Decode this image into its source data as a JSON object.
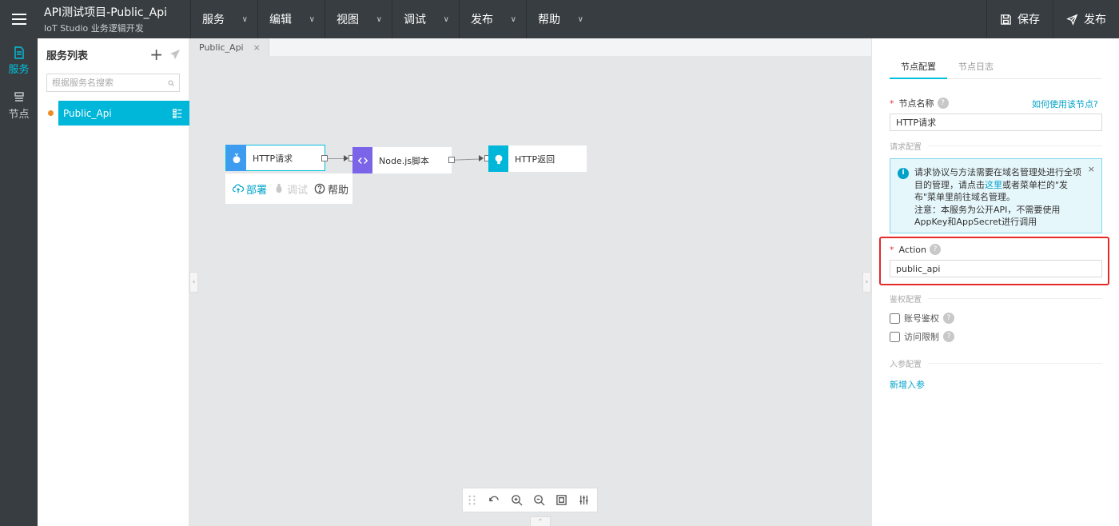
{
  "header": {
    "project_title": "API测试项目-Public_Api",
    "subtitle": "IoT Studio 业务逻辑开发",
    "menus": [
      {
        "label": "服务"
      },
      {
        "label": "编辑"
      },
      {
        "label": "视图"
      },
      {
        "label": "调试"
      },
      {
        "label": "发布"
      },
      {
        "label": "帮助"
      }
    ],
    "save_label": "保存",
    "publish_label": "发布"
  },
  "rail": {
    "items": [
      {
        "label": "服务",
        "icon": "document-icon",
        "active": true
      },
      {
        "label": "节点",
        "icon": "node-list-icon",
        "active": false
      }
    ]
  },
  "service_list": {
    "title": "服务列表",
    "search_placeholder": "根据服务名搜索",
    "items": [
      {
        "name": "Public_Api",
        "selected": true,
        "status_color": "#f08a24"
      }
    ]
  },
  "canvas": {
    "tab": {
      "label": "Public_Api",
      "close": "×"
    },
    "nodes": [
      {
        "label": "HTTP请求",
        "icon": "http-request-icon",
        "color": "#3d9cf0"
      },
      {
        "label": "Node.js脚本",
        "icon": "code-icon",
        "color": "#7b64e8"
      },
      {
        "label": "HTTP返回",
        "icon": "http-response-icon",
        "color": "#00b6d9"
      }
    ],
    "node_toolbar": {
      "deploy": "部署",
      "debug": "调试",
      "help": "帮助"
    }
  },
  "config": {
    "tabs": [
      {
        "label": "节点配置",
        "active": true
      },
      {
        "label": "节点日志",
        "active": false
      }
    ],
    "node_name_label": "节点名称",
    "how_to_link": "如何使用该节点?",
    "node_name_value": "HTTP请求",
    "request_section": "请求配置",
    "notice": {
      "line1": "请求协议与方法需要在域名管理处进行全项目的管理，请点击",
      "link": "这里",
      "line2": "或者菜单栏的\"发布\"菜单里前往域名管理。",
      "note": "注意：本服务为公开API，不需要使用AppKey和AppSecret进行调用",
      "close": "×"
    },
    "action_label": "Action",
    "action_value": "public_api",
    "auth_section": "鉴权配置",
    "account_auth": "账号鉴权",
    "access_limit": "访问限制",
    "input_section": "入参配置",
    "add_param": "新增入参"
  },
  "colors": {
    "topbar": "#373d41",
    "accent": "#00c1de",
    "highlight": "#e52a2a"
  }
}
